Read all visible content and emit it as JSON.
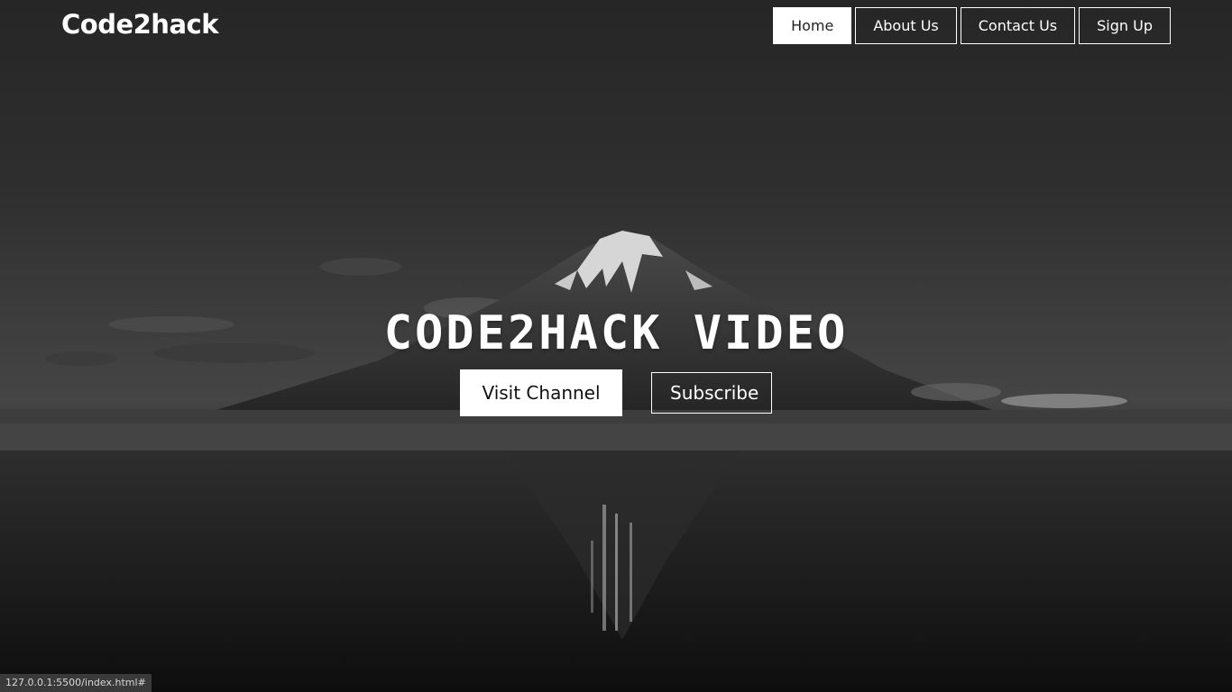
{
  "header": {
    "logo": "Code2hack",
    "nav": [
      {
        "label": "Home",
        "active": true
      },
      {
        "label": "About Us",
        "active": false
      },
      {
        "label": "Contact Us",
        "active": false
      },
      {
        "label": "Sign Up",
        "active": false
      }
    ]
  },
  "hero": {
    "title": "CODE2HACK VIDEO",
    "primary_button": "Visit Channel",
    "secondary_button": "Subscribe"
  },
  "status_bar": {
    "url": "127.0.0.1:5500/index.html#"
  },
  "colors": {
    "accent": "#ffffff",
    "text_dark": "#111111"
  }
}
